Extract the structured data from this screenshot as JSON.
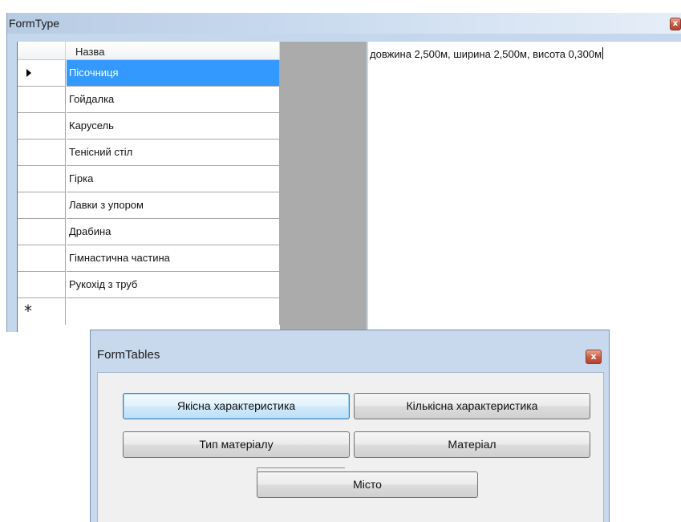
{
  "form_type": {
    "title": "FormType",
    "close_glyph": "x",
    "grid": {
      "column_header": "Назва",
      "selected_index": 0,
      "rows": [
        "Пісочниця",
        "Гойдалка",
        "Карусель",
        "Тенісний стіл",
        "Гірка",
        "Лавки з упором",
        "Драбина",
        "Гімнастична частина",
        "Рукохід з труб"
      ],
      "new_row_marker": "*"
    },
    "description_text": "довжина 2,500м, ширина 2,500м, висота 0,300м"
  },
  "form_tables": {
    "title": "FormTables",
    "close_glyph": "x",
    "buttons": {
      "quality": "Якісна характеристика",
      "quantity": "Кількісна характеристика",
      "material_type": "Тип матеріалу",
      "material": "Матеріал",
      "city": "Місто"
    }
  },
  "colors": {
    "selection": "#3399ff",
    "window_frame": "#c5d7ec",
    "close_button": "#c75a43"
  }
}
